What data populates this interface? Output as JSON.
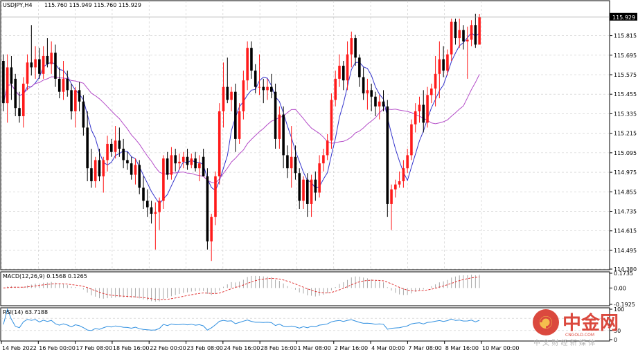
{
  "chart_header": {
    "symbol_label": "USDJPY,H4",
    "ohlc_text": "115.760 115.949 115.760 115.929"
  },
  "price_tag": "115.929",
  "price_axis_labels": [
    "115.815",
    "115.695",
    "115.575",
    "115.455",
    "115.335",
    "115.215",
    "115.095",
    "114.975",
    "114.855",
    "114.735",
    "114.615",
    "114.495",
    "114.380"
  ],
  "macd_panel": {
    "label": "MACD(12,26,9) 0.1568 0.1265",
    "axis_labels": [
      "0.1735",
      "0.00",
      "-0.1925"
    ]
  },
  "rsi_panel": {
    "label": "RSI(14) 63.7188",
    "axis_labels": [
      "100",
      "30",
      "0"
    ]
  },
  "time_labels": [
    "14 Feb 2022",
    "16 Feb 00:00",
    "17 Feb 08:00",
    "18 Feb 16:00",
    "22 Feb 00:00",
    "23 Feb 08:00",
    "24 Feb 16:00",
    "28 Feb 16:00",
    "1 Mar 08:00",
    "2 Mar 16:00",
    "4 Mar 00:00",
    "7 Mar 08:00",
    "8 Mar 16:00",
    "10 Mar 00:00"
  ],
  "watermark": {
    "brand_cn": "中金网",
    "domain": "CNGOLD.COM",
    "tagline_cn": "中 文 财 经 新 媒 体"
  },
  "colors": {
    "bull": "#ff1a1a",
    "bear": "#000000",
    "ma_fast": "#3333cc",
    "ma_slow": "#b44cc8",
    "macd_signal": "#e03030",
    "macd_hist": "#a8a8a8",
    "rsi_line": "#2f8fe0",
    "grid": "#c8c8c8",
    "logo_red": "#d8362a"
  },
  "chart_data": {
    "type": "candlestick",
    "symbol": "USDJPY",
    "timeframe": "H4",
    "price_range": [
      114.38,
      116.03
    ],
    "grid": true,
    "candles": [
      {
        "o": 115.66,
        "h": 115.7,
        "l": 115.35,
        "c": 115.4
      },
      {
        "o": 115.4,
        "h": 115.7,
        "l": 115.28,
        "c": 115.62
      },
      {
        "o": 115.62,
        "h": 115.69,
        "l": 115.42,
        "c": 115.52
      },
      {
        "o": 115.55,
        "h": 115.58,
        "l": 115.32,
        "c": 115.37
      },
      {
        "o": 115.37,
        "h": 115.47,
        "l": 115.28,
        "c": 115.32
      },
      {
        "o": 115.32,
        "h": 115.56,
        "l": 115.25,
        "c": 115.52
      },
      {
        "o": 115.52,
        "h": 115.7,
        "l": 115.48,
        "c": 115.65
      },
      {
        "o": 115.65,
        "h": 115.88,
        "l": 115.57,
        "c": 115.62
      },
      {
        "o": 115.62,
        "h": 115.75,
        "l": 115.55,
        "c": 115.67
      },
      {
        "o": 115.67,
        "h": 115.74,
        "l": 115.55,
        "c": 115.58
      },
      {
        "o": 115.58,
        "h": 115.75,
        "l": 115.55,
        "c": 115.69
      },
      {
        "o": 115.69,
        "h": 115.8,
        "l": 115.62,
        "c": 115.64
      },
      {
        "o": 115.64,
        "h": 115.78,
        "l": 115.58,
        "c": 115.71
      },
      {
        "o": 115.71,
        "h": 115.76,
        "l": 115.5,
        "c": 115.55
      },
      {
        "o": 115.55,
        "h": 115.62,
        "l": 115.43,
        "c": 115.47
      },
      {
        "o": 115.47,
        "h": 115.66,
        "l": 115.42,
        "c": 115.55
      },
      {
        "o": 115.55,
        "h": 115.6,
        "l": 115.44,
        "c": 115.48
      },
      {
        "o": 115.48,
        "h": 115.52,
        "l": 115.3,
        "c": 115.35
      },
      {
        "o": 115.35,
        "h": 115.5,
        "l": 115.25,
        "c": 115.48
      },
      {
        "o": 115.48,
        "h": 115.53,
        "l": 115.35,
        "c": 115.41
      },
      {
        "o": 115.41,
        "h": 115.45,
        "l": 115.2,
        "c": 115.25
      },
      {
        "o": 115.25,
        "h": 115.35,
        "l": 114.92,
        "c": 115.0
      },
      {
        "o": 115.0,
        "h": 115.12,
        "l": 114.88,
        "c": 114.92
      },
      {
        "o": 114.92,
        "h": 115.07,
        "l": 114.88,
        "c": 115.05
      },
      {
        "o": 115.05,
        "h": 115.12,
        "l": 114.92,
        "c": 114.95
      },
      {
        "o": 114.95,
        "h": 115.07,
        "l": 114.85,
        "c": 115.05
      },
      {
        "o": 115.05,
        "h": 115.2,
        "l": 114.98,
        "c": 115.15
      },
      {
        "o": 115.15,
        "h": 115.18,
        "l": 115.07,
        "c": 115.1
      },
      {
        "o": 115.1,
        "h": 115.26,
        "l": 115.06,
        "c": 115.17
      },
      {
        "o": 115.17,
        "h": 115.25,
        "l": 115.07,
        "c": 115.12
      },
      {
        "o": 115.12,
        "h": 115.18,
        "l": 115.0,
        "c": 115.05
      },
      {
        "o": 115.05,
        "h": 115.1,
        "l": 114.99,
        "c": 115.03
      },
      {
        "o": 115.03,
        "h": 115.07,
        "l": 114.93,
        "c": 114.96
      },
      {
        "o": 114.96,
        "h": 115.06,
        "l": 114.9,
        "c": 115.02
      },
      {
        "o": 115.02,
        "h": 115.05,
        "l": 114.84,
        "c": 114.88
      },
      {
        "o": 114.88,
        "h": 114.95,
        "l": 114.75,
        "c": 114.8
      },
      {
        "o": 114.8,
        "h": 114.87,
        "l": 114.7,
        "c": 114.76
      },
      {
        "o": 114.76,
        "h": 114.8,
        "l": 114.66,
        "c": 114.72
      },
      {
        "o": 114.72,
        "h": 114.79,
        "l": 114.5,
        "c": 114.73
      },
      {
        "o": 114.73,
        "h": 114.82,
        "l": 114.62,
        "c": 114.8
      },
      {
        "o": 114.8,
        "h": 115.08,
        "l": 114.75,
        "c": 115.06
      },
      {
        "o": 115.06,
        "h": 115.1,
        "l": 114.93,
        "c": 114.96
      },
      {
        "o": 114.96,
        "h": 115.13,
        "l": 114.93,
        "c": 115.08
      },
      {
        "o": 115.08,
        "h": 115.12,
        "l": 114.98,
        "c": 115.03
      },
      {
        "o": 115.03,
        "h": 115.09,
        "l": 114.99,
        "c": 115.04
      },
      {
        "o": 115.04,
        "h": 115.1,
        "l": 115.0,
        "c": 115.07
      },
      {
        "o": 115.07,
        "h": 115.12,
        "l": 114.99,
        "c": 115.02
      },
      {
        "o": 115.02,
        "h": 115.09,
        "l": 115.0,
        "c": 115.06
      },
      {
        "o": 115.06,
        "h": 115.1,
        "l": 114.98,
        "c": 115.0
      },
      {
        "o": 115.0,
        "h": 115.08,
        "l": 114.92,
        "c": 115.03
      },
      {
        "o": 115.07,
        "h": 115.12,
        "l": 114.95,
        "c": 114.95
      },
      {
        "o": 114.95,
        "h": 115.0,
        "l": 114.5,
        "c": 114.55
      },
      {
        "o": 114.55,
        "h": 114.72,
        "l": 114.43,
        "c": 114.7
      },
      {
        "o": 114.7,
        "h": 114.98,
        "l": 114.65,
        "c": 114.95
      },
      {
        "o": 114.95,
        "h": 115.4,
        "l": 114.9,
        "c": 115.35
      },
      {
        "o": 115.35,
        "h": 115.65,
        "l": 115.25,
        "c": 115.5
      },
      {
        "o": 115.5,
        "h": 115.68,
        "l": 115.4,
        "c": 115.42
      },
      {
        "o": 115.42,
        "h": 115.5,
        "l": 115.35,
        "c": 115.47
      },
      {
        "o": 115.47,
        "h": 115.52,
        "l": 115.1,
        "c": 115.18
      },
      {
        "o": 115.18,
        "h": 115.4,
        "l": 115.15,
        "c": 115.35
      },
      {
        "o": 115.35,
        "h": 115.6,
        "l": 115.3,
        "c": 115.54
      },
      {
        "o": 115.54,
        "h": 115.78,
        "l": 115.48,
        "c": 115.74
      },
      {
        "o": 115.74,
        "h": 115.78,
        "l": 115.55,
        "c": 115.6
      },
      {
        "o": 115.6,
        "h": 115.64,
        "l": 115.46,
        "c": 115.5
      },
      {
        "o": 115.5,
        "h": 115.7,
        "l": 115.45,
        "c": 115.5
      },
      {
        "o": 115.5,
        "h": 115.55,
        "l": 115.4,
        "c": 115.48
      },
      {
        "o": 115.48,
        "h": 115.55,
        "l": 115.42,
        "c": 115.5
      },
      {
        "o": 115.5,
        "h": 115.58,
        "l": 115.43,
        "c": 115.47
      },
      {
        "o": 115.47,
        "h": 115.52,
        "l": 115.12,
        "c": 115.18
      },
      {
        "o": 115.18,
        "h": 115.38,
        "l": 115.12,
        "c": 115.33
      },
      {
        "o": 115.33,
        "h": 115.38,
        "l": 115.0,
        "c": 115.08
      },
      {
        "o": 115.08,
        "h": 115.14,
        "l": 114.94,
        "c": 115.0
      },
      {
        "o": 115.0,
        "h": 115.26,
        "l": 114.88,
        "c": 115.07
      },
      {
        "o": 115.07,
        "h": 115.14,
        "l": 114.93,
        "c": 114.97
      },
      {
        "o": 114.97,
        "h": 115.0,
        "l": 114.75,
        "c": 114.8
      },
      {
        "o": 114.8,
        "h": 114.95,
        "l": 114.75,
        "c": 114.93
      },
      {
        "o": 114.93,
        "h": 114.97,
        "l": 114.7,
        "c": 114.78
      },
      {
        "o": 114.78,
        "h": 114.96,
        "l": 114.7,
        "c": 114.93
      },
      {
        "o": 114.93,
        "h": 114.98,
        "l": 114.8,
        "c": 114.85
      },
      {
        "o": 114.85,
        "h": 115.08,
        "l": 114.82,
        "c": 115.03
      },
      {
        "o": 115.03,
        "h": 115.12,
        "l": 114.98,
        "c": 115.08
      },
      {
        "o": 115.08,
        "h": 115.21,
        "l": 115.05,
        "c": 115.17
      },
      {
        "o": 115.17,
        "h": 115.46,
        "l": 115.12,
        "c": 115.42
      },
      {
        "o": 115.42,
        "h": 115.6,
        "l": 115.38,
        "c": 115.55
      },
      {
        "o": 115.55,
        "h": 115.7,
        "l": 115.5,
        "c": 115.63
      },
      {
        "o": 115.63,
        "h": 115.66,
        "l": 115.48,
        "c": 115.54
      },
      {
        "o": 115.54,
        "h": 115.78,
        "l": 115.48,
        "c": 115.7
      },
      {
        "o": 115.7,
        "h": 115.84,
        "l": 115.62,
        "c": 115.8
      },
      {
        "o": 115.8,
        "h": 115.82,
        "l": 115.63,
        "c": 115.68
      },
      {
        "o": 115.68,
        "h": 115.7,
        "l": 115.5,
        "c": 115.56
      },
      {
        "o": 115.56,
        "h": 115.62,
        "l": 115.42,
        "c": 115.46
      },
      {
        "o": 115.46,
        "h": 115.55,
        "l": 115.36,
        "c": 115.48
      },
      {
        "o": 115.48,
        "h": 115.52,
        "l": 115.35,
        "c": 115.44
      },
      {
        "o": 115.44,
        "h": 115.47,
        "l": 115.32,
        "c": 115.38
      },
      {
        "o": 115.38,
        "h": 115.45,
        "l": 115.3,
        "c": 115.41
      },
      {
        "o": 115.41,
        "h": 115.48,
        "l": 115.35,
        "c": 115.38
      },
      {
        "o": 115.38,
        "h": 115.42,
        "l": 114.7,
        "c": 114.78
      },
      {
        "o": 114.78,
        "h": 114.9,
        "l": 114.62,
        "c": 114.87
      },
      {
        "o": 114.87,
        "h": 114.93,
        "l": 114.82,
        "c": 114.9
      },
      {
        "o": 114.9,
        "h": 114.98,
        "l": 114.88,
        "c": 114.92
      },
      {
        "o": 114.92,
        "h": 115.05,
        "l": 114.88,
        "c": 115.0
      },
      {
        "o": 115.0,
        "h": 115.12,
        "l": 114.97,
        "c": 115.08
      },
      {
        "o": 115.08,
        "h": 115.3,
        "l": 115.05,
        "c": 115.27
      },
      {
        "o": 115.27,
        "h": 115.4,
        "l": 115.22,
        "c": 115.35
      },
      {
        "o": 115.35,
        "h": 115.44,
        "l": 115.28,
        "c": 115.39
      },
      {
        "o": 115.39,
        "h": 115.48,
        "l": 115.22,
        "c": 115.28
      },
      {
        "o": 115.28,
        "h": 115.5,
        "l": 115.25,
        "c": 115.45
      },
      {
        "o": 115.45,
        "h": 115.52,
        "l": 115.4,
        "c": 115.49
      },
      {
        "o": 115.49,
        "h": 115.69,
        "l": 115.38,
        "c": 115.58
      },
      {
        "o": 115.58,
        "h": 115.78,
        "l": 115.43,
        "c": 115.67
      },
      {
        "o": 115.67,
        "h": 115.75,
        "l": 115.56,
        "c": 115.6
      },
      {
        "o": 115.6,
        "h": 115.73,
        "l": 115.57,
        "c": 115.7
      },
      {
        "o": 115.7,
        "h": 115.92,
        "l": 115.66,
        "c": 115.9
      },
      {
        "o": 115.9,
        "h": 115.92,
        "l": 115.76,
        "c": 115.8
      },
      {
        "o": 115.8,
        "h": 115.92,
        "l": 115.74,
        "c": 115.85
      },
      {
        "o": 115.85,
        "h": 115.88,
        "l": 115.73,
        "c": 115.78
      },
      {
        "o": 115.78,
        "h": 115.87,
        "l": 115.55,
        "c": 115.79
      },
      {
        "o": 115.79,
        "h": 115.91,
        "l": 115.75,
        "c": 115.88
      },
      {
        "o": 115.88,
        "h": 115.95,
        "l": 115.74,
        "c": 115.76
      },
      {
        "o": 115.76,
        "h": 115.949,
        "l": 115.76,
        "c": 115.929
      }
    ],
    "moving_averages": [
      {
        "color_key": "ma_fast",
        "period": 6
      },
      {
        "color_key": "ma_slow",
        "period": 20
      }
    ],
    "indicators": {
      "macd": {
        "main": 0.1568,
        "signal": 0.1265,
        "range": [
          -0.1925,
          0.1735
        ]
      },
      "rsi": {
        "value": 63.7188,
        "range": [
          0,
          100
        ]
      }
    }
  }
}
